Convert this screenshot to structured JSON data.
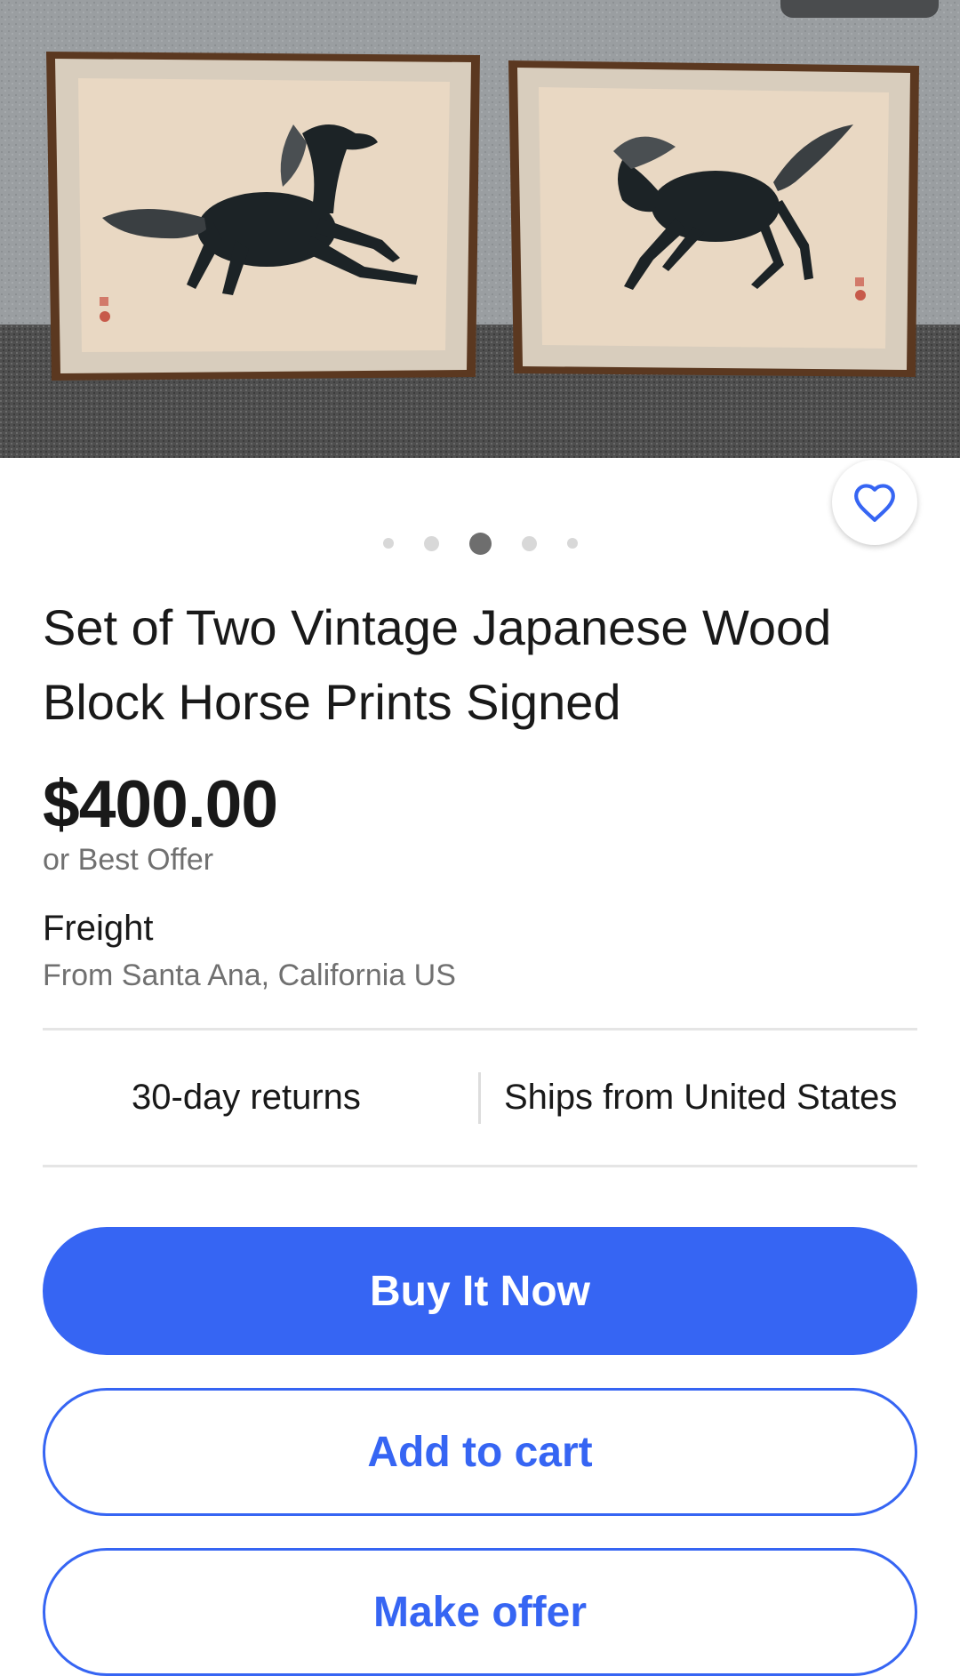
{
  "listing": {
    "title": "Set of Two Vintage Japanese Wood Block Horse Prints Signed",
    "price": "$400.00",
    "price_note": "or Best Offer",
    "shipping_method": "Freight",
    "shipping_from": "From Santa Ana, California US"
  },
  "carousel": {
    "total_images": 5,
    "active_index": 3
  },
  "features": {
    "returns": "30-day returns",
    "ships_from": "Ships from United States"
  },
  "actions": {
    "buy_now": "Buy It Now",
    "add_to_cart": "Add to cart",
    "make_offer": "Make offer"
  },
  "icons": {
    "watch": "heart-icon"
  },
  "colors": {
    "accent": "#3665f3",
    "text_primary": "#191919",
    "text_secondary": "#707070",
    "divider": "#e5e5e5"
  }
}
